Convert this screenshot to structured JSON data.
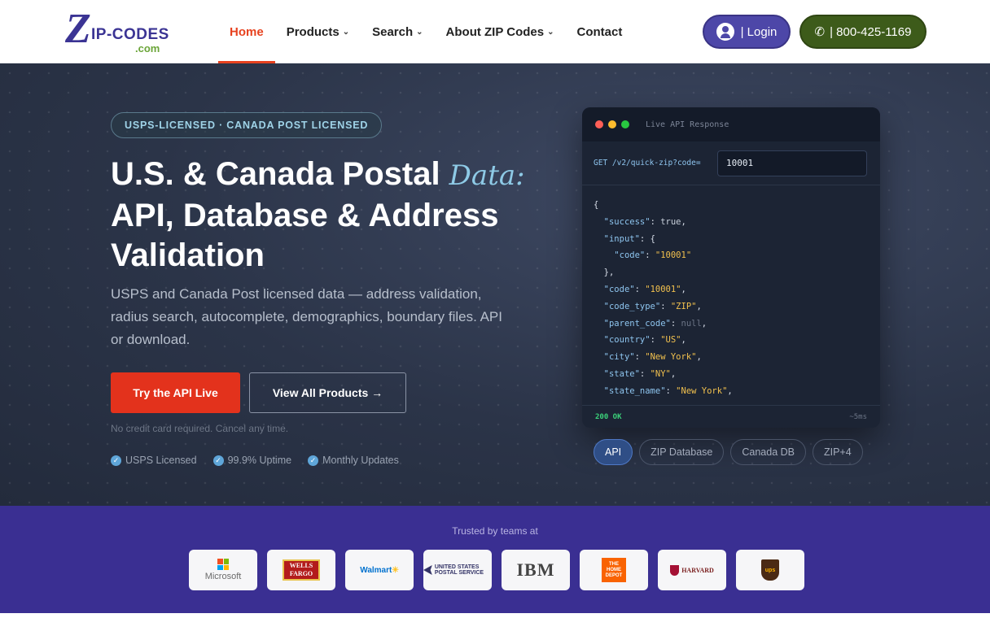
{
  "nav": {
    "logo": {
      "z": "Z",
      "rest": "IP-CODES",
      "com": ".com"
    },
    "menu": [
      {
        "label": "Home",
        "active": true
      },
      {
        "label": "Products",
        "chevron": true
      },
      {
        "label": "Search",
        "chevron": true
      },
      {
        "label": "About ZIP Codes",
        "chevron": true
      },
      {
        "label": "Contact"
      }
    ],
    "login_label": "| Login",
    "phone_label": "| 800-425-1169"
  },
  "hero": {
    "badge": "USPS-LICENSED · CANADA POST LICENSED",
    "title_line1": "U.S. & Canada Postal ",
    "title_script": "Data:",
    "title_line2": "API, Database & Address Validation",
    "subtitle": "USPS and Canada Post licensed data — address validation, radius search, autocomplete, demographics, boundary files. API or download.",
    "cta_primary": "Try the API Live",
    "cta_secondary": "View All Products →",
    "note": "No credit card required. Cancel any time.",
    "checks": [
      "USPS Licensed",
      "99.9% Uptime",
      "Monthly Updates"
    ]
  },
  "api_card": {
    "title": "Live API Response",
    "request_label": "GET /v2/quick-zip?code=",
    "request_value": "10001",
    "response_lines": [
      "{",
      "  \"success\": true,",
      "  \"input\": {",
      "    \"code\": \"10001\"",
      "  },",
      "  \"code\": \"10001\",",
      "  \"code_type\": \"ZIP\",",
      "  \"parent_code\": null,",
      "  \"country\": \"US\",",
      "  \"city\": \"New York\",",
      "  \"state\": \"NY\",",
      "  \"state_name\": \"New York\","
    ],
    "status": "200 OK",
    "latency": "~5ms",
    "tabs": [
      {
        "label": "API",
        "active": true
      },
      {
        "label": "ZIP Database"
      },
      {
        "label": "Canada DB"
      },
      {
        "label": "ZIP+4"
      }
    ]
  },
  "trusted": {
    "title": "Trusted by teams at",
    "logos": [
      "microsoft-logo",
      "wells-fargo-logo",
      "walmart-logo",
      "usps-logo",
      "ibm-logo",
      "home-depot-logo",
      "harvard-logo",
      "ups-logo"
    ],
    "labels": {
      "microsoft": "Microsoft",
      "wells_fargo": "WELLS FARGO",
      "walmart": "Walmart",
      "usps": "UNITED STATES POSTAL SERVICE",
      "ibm": "IBM",
      "home_depot": "THE HOME DEPOT",
      "harvard": "HARVARD",
      "ups": "ups"
    }
  },
  "colors": {
    "accent_red": "#e3321c",
    "brand_purple": "#3a2f92",
    "login_bg": "#4d47a8",
    "phone_bg": "#3d5b1a",
    "json_key": "#8ec5ef",
    "json_string": "#f2c14e"
  }
}
